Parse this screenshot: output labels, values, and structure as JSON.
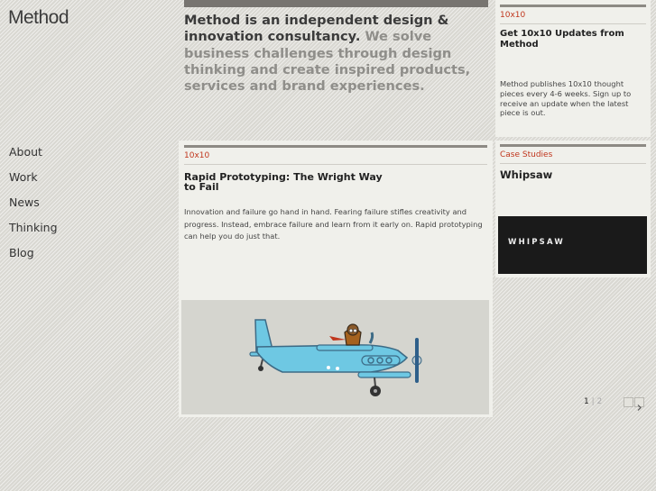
{
  "brand": {
    "logo": "Method"
  },
  "nav": {
    "items": [
      {
        "label": "About"
      },
      {
        "label": "Work"
      },
      {
        "label": "News"
      },
      {
        "label": "Thinking"
      },
      {
        "label": "Blog"
      }
    ]
  },
  "intro": {
    "lead": "Method is an independent design & innovation consultancy.",
    "rest": " We solve business challenges through design thinking and create inspired products, services and brand experiences."
  },
  "promo": {
    "tag": "10x10",
    "title": "Get 10x10 Updates from Method",
    "desc": "Method publishes 10x10 thought pieces every 4-6 weeks. Sign up to receive an update when the latest piece is out."
  },
  "feature": {
    "tag": "10x10",
    "title": "Rapid Prototyping: The Wright Way to Fail",
    "desc": "Innovation and failure go hand in hand. Fearing failure stifles creativity and progress. Instead, embrace failure and learn from it early on. Rapid prototyping can help you do just that."
  },
  "case": {
    "tag": "Case Studies",
    "title": "Whipsaw",
    "brand_text": "WHIPSAW"
  },
  "pager": {
    "current": "1",
    "sep": "|",
    "next": "2"
  },
  "colors": {
    "accent": "#c0361d",
    "panel": "#f0f0eb",
    "plane": "#6ec8e3"
  }
}
